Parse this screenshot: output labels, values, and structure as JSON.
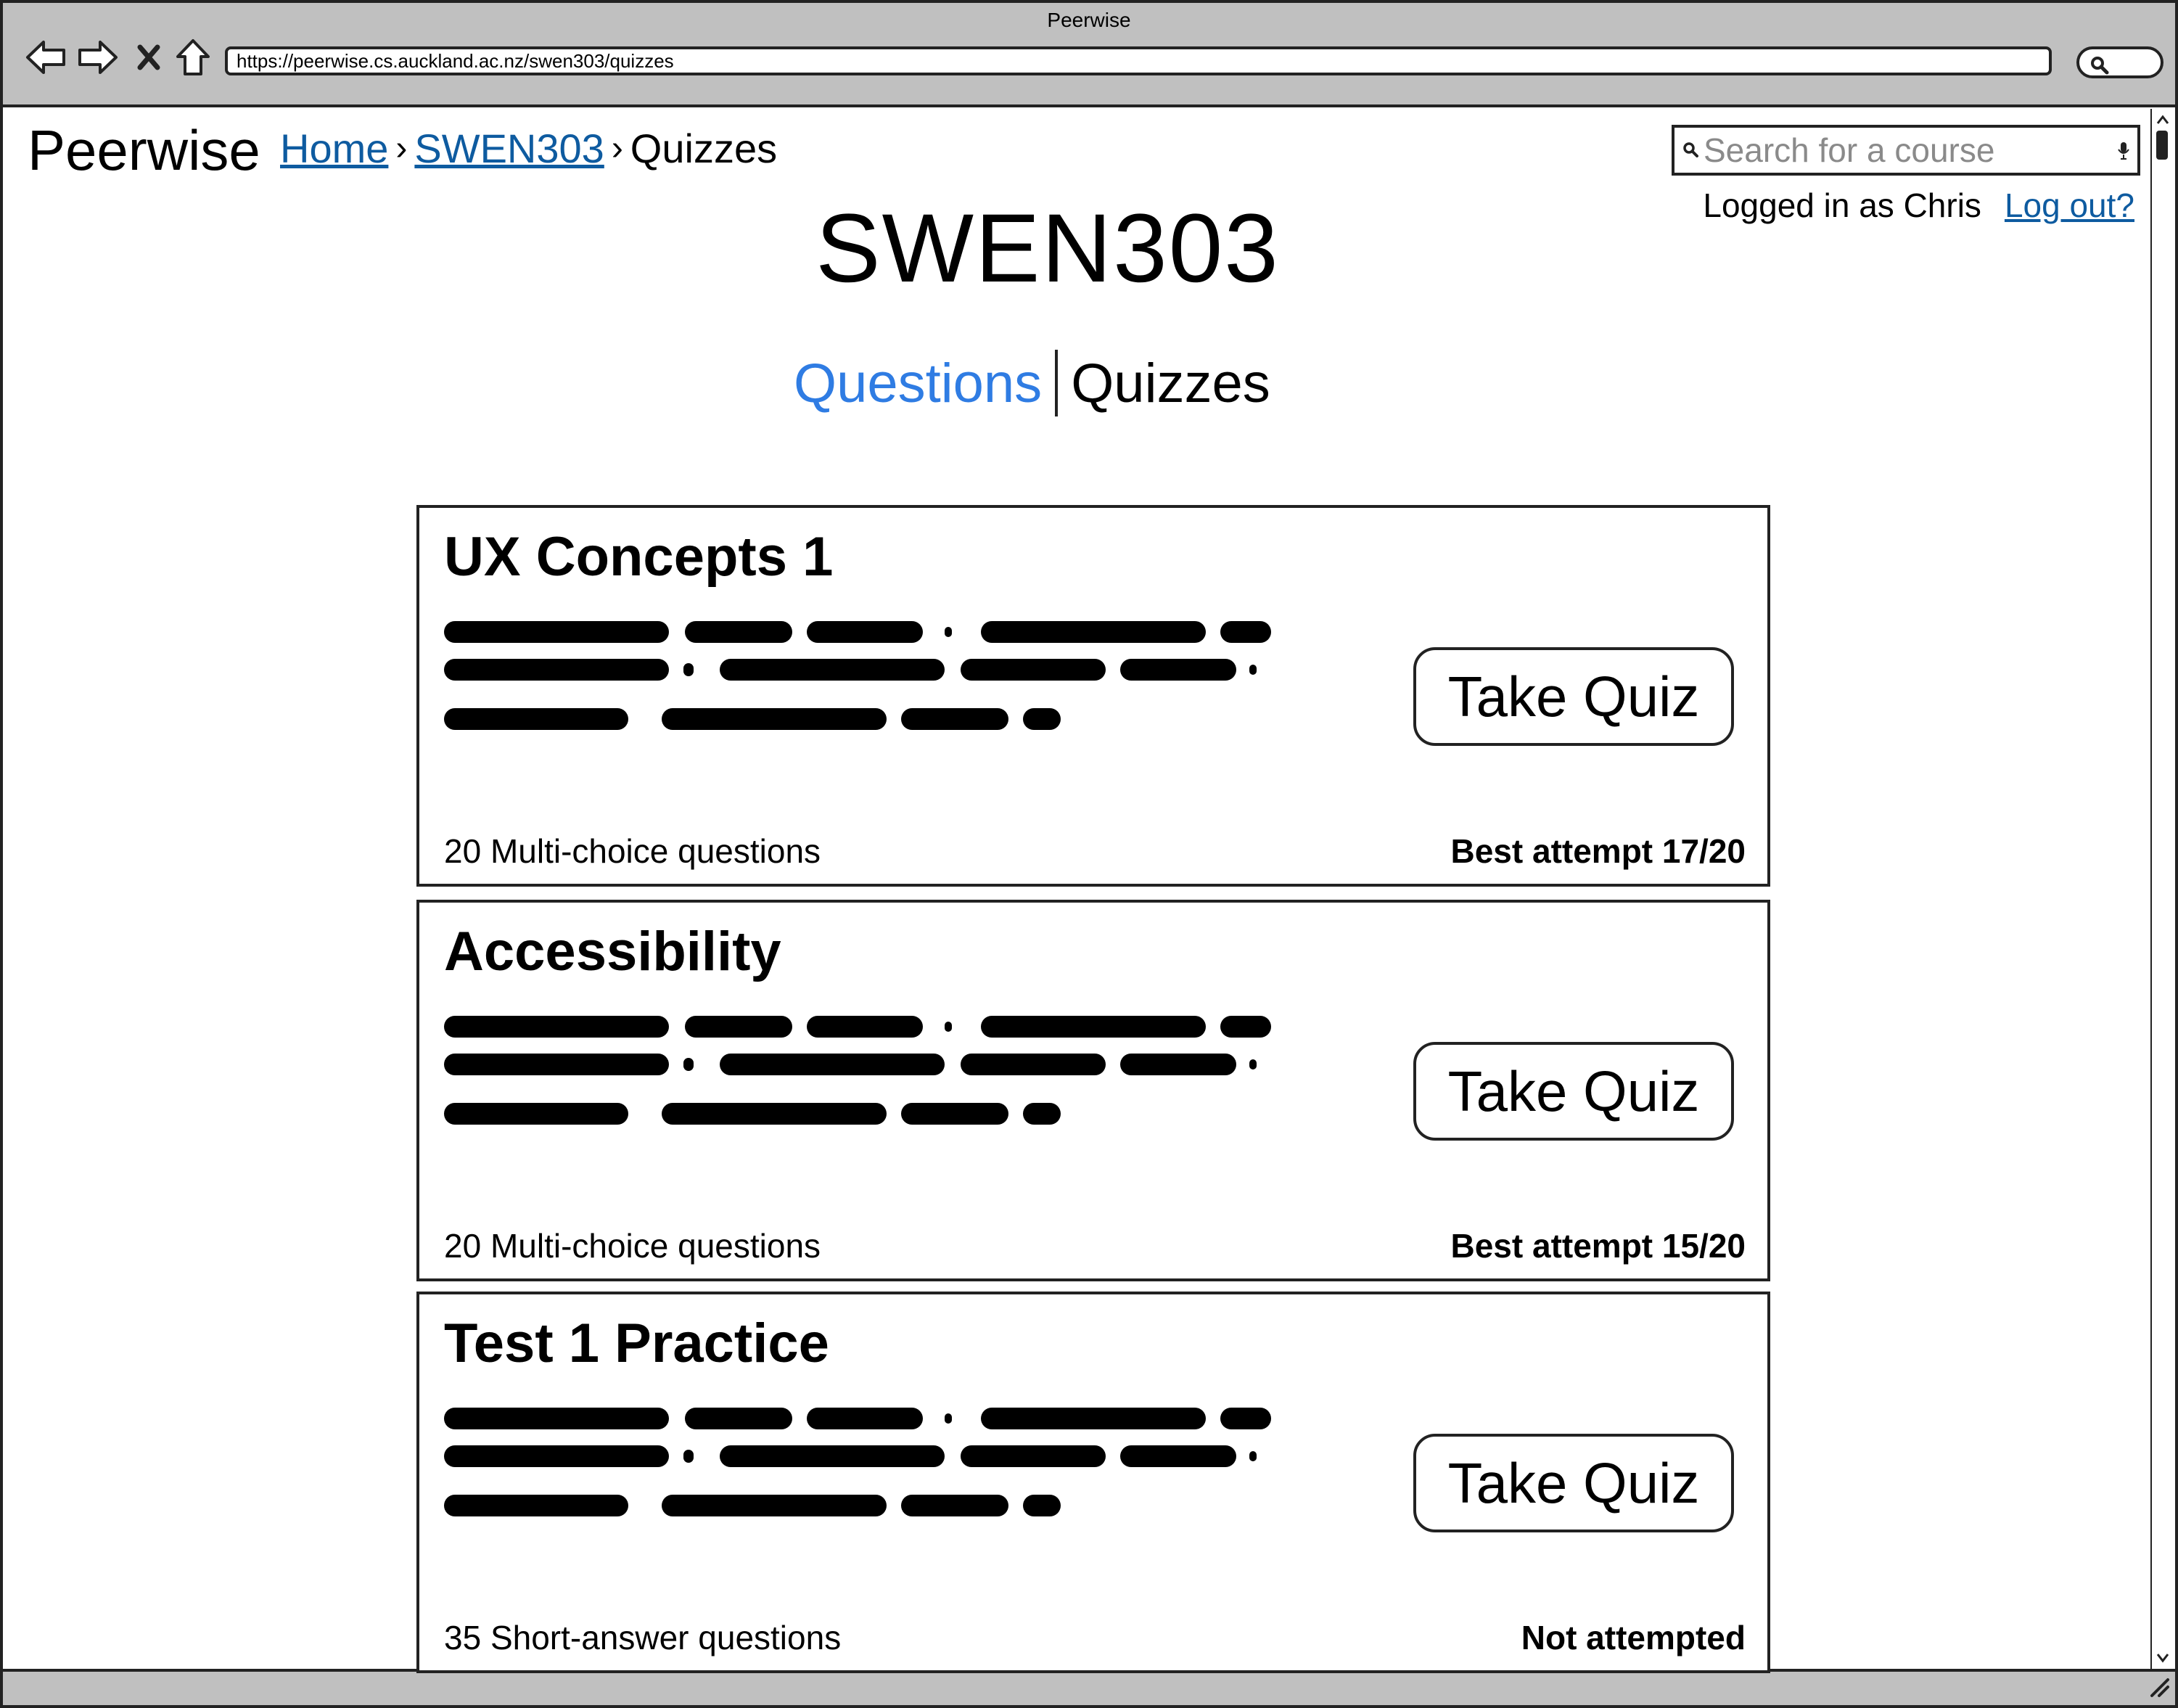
{
  "browser": {
    "window_title": "Peerwise",
    "url": "https://peerwise.cs.auckland.ac.nz/swen303/quizzes"
  },
  "header": {
    "brand": "Peerwise",
    "breadcrumb": {
      "home": "Home",
      "course": "SWEN303",
      "current": "Quizzes",
      "separator": "›"
    },
    "search": {
      "placeholder": "Search for a course"
    },
    "user": {
      "status": "Logged in as Chris",
      "logout": "Log out?"
    }
  },
  "page": {
    "title": "SWEN303",
    "tabs": [
      {
        "label": "Questions",
        "active": true
      },
      {
        "label": "Quizzes",
        "active": false
      }
    ]
  },
  "quizzes": [
    {
      "title": "UX Concepts 1",
      "button": "Take Quiz",
      "meta": "20 Multi-choice questions",
      "attempt": "Best attempt 17/20"
    },
    {
      "title": "Accessibility",
      "button": "Take Quiz",
      "meta": "20 Multi-choice questions",
      "attempt": "Best attempt 15/20"
    },
    {
      "title": "Test 1 Practice",
      "button": "Take Quiz",
      "meta": "35 Short-answer questions",
      "attempt": "Not attempted"
    }
  ],
  "colors": {
    "link": "#0e5ba0",
    "active_tab": "#2f7ce3",
    "chrome": "#c0c0c0"
  },
  "icons": [
    "back-arrow-icon",
    "forward-arrow-icon",
    "stop-icon",
    "home-icon",
    "search-icon",
    "microphone-icon",
    "resize-grip-icon"
  ]
}
